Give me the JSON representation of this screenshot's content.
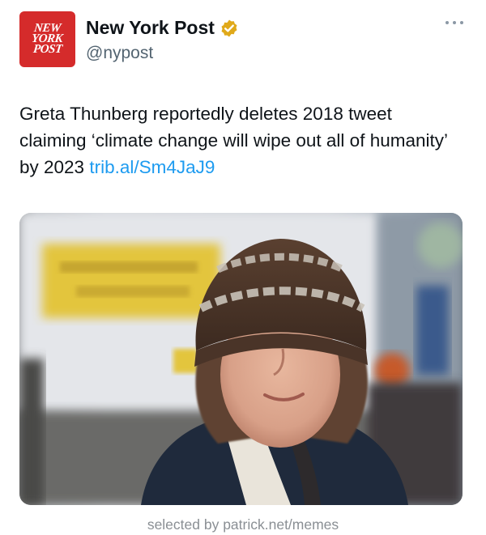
{
  "account": {
    "logo_lines": [
      "NEW",
      "YORK",
      "POST"
    ],
    "display_name": "New York Post",
    "handle": "@nypost",
    "verified_badge_color": "#e0a91a",
    "logo_color": "#d52b2b"
  },
  "tweet": {
    "text": "Greta Thunberg reportedly deletes 2018 tweet claiming ‘climate change will wipe out all of humanity’ by 2023 ",
    "link": "trib.al/Sm4JaJ9",
    "link_color": "#1d9bf0"
  },
  "icons": {
    "more": "more-options-icon",
    "verified": "verified-badge-icon"
  },
  "footer": {
    "credit": "selected by patrick.net/memes"
  }
}
